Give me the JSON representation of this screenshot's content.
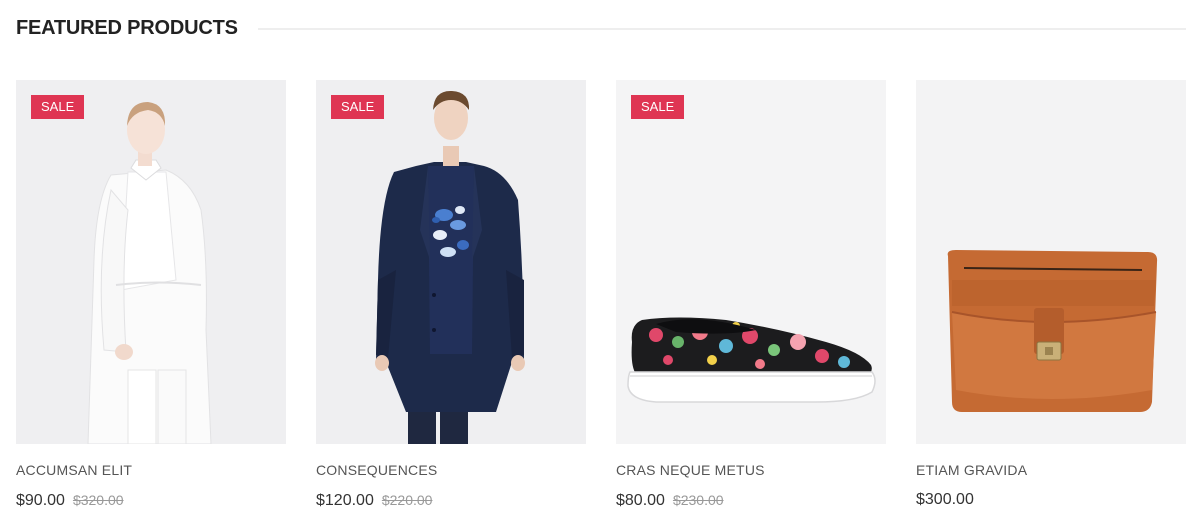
{
  "section": {
    "title": "FEATURED PRODUCTS"
  },
  "products": [
    {
      "name": "ACCUMSAN ELIT",
      "badge": "SALE",
      "price": "$90.00",
      "old_price": "$320.00",
      "image": "woman-in-white-outfit"
    },
    {
      "name": "CONSEQUENCES",
      "badge": "SALE",
      "price": "$120.00",
      "old_price": "$220.00",
      "image": "man-in-navy-coat"
    },
    {
      "name": "CRAS NEQUE METUS",
      "badge": "SALE",
      "price": "$80.00",
      "old_price": "$230.00",
      "image": "floral-slip-on-sneaker"
    },
    {
      "name": "ETIAM GRAVIDA",
      "price": "$300.00",
      "image": "tan-leather-crossbody-bag"
    }
  ],
  "colors": {
    "sale_badge": "#df3553",
    "image_background": "#efeff1"
  }
}
